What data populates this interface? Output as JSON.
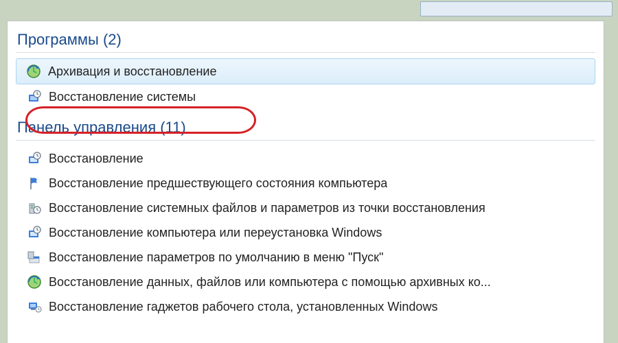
{
  "sections": {
    "programs": {
      "label": "Программы",
      "count": "(2)",
      "items": [
        {
          "label": "Архивация и восстановление",
          "icon": "backup-restore-icon",
          "selected": true
        },
        {
          "label": "Восстановление системы",
          "icon": "system-restore-icon",
          "highlighted": true
        }
      ]
    },
    "control_panel": {
      "label": "Панель управления",
      "count": "(11)",
      "items": [
        {
          "label": "Восстановление",
          "icon": "recovery-icon"
        },
        {
          "label": "Восстановление предшествующего состояния компьютера",
          "icon": "flag-icon"
        },
        {
          "label": "Восстановление системных файлов и параметров из точки восстановления",
          "icon": "restore-point-icon"
        },
        {
          "label": "Восстановление компьютера или переустановка Windows",
          "icon": "reinstall-icon"
        },
        {
          "label": "Восстановление параметров по умолчанию в меню \"Пуск\"",
          "icon": "start-menu-icon"
        },
        {
          "label": "Восстановление данных, файлов или компьютера с помощью архивных ко...",
          "icon": "backup-restore-icon"
        },
        {
          "label": "Восстановление гаджетов рабочего стола, установленных Windows",
          "icon": "gadgets-icon"
        }
      ]
    }
  }
}
